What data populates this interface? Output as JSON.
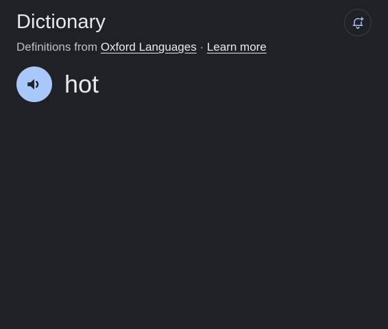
{
  "header": {
    "title": "Dictionary",
    "alert_icon": "bell-add-icon"
  },
  "source": {
    "prefix": "Definitions from ",
    "provider_link": "Oxford Languages",
    "separator": " · ",
    "learn_more": "Learn more"
  },
  "entry": {
    "word": "hot",
    "pronounce_icon": "speaker-icon"
  },
  "colors": {
    "background": "#202124",
    "speaker_button": "#a8c7fa",
    "text_primary": "#e8eaed",
    "text_secondary": "#bdc1c6"
  }
}
